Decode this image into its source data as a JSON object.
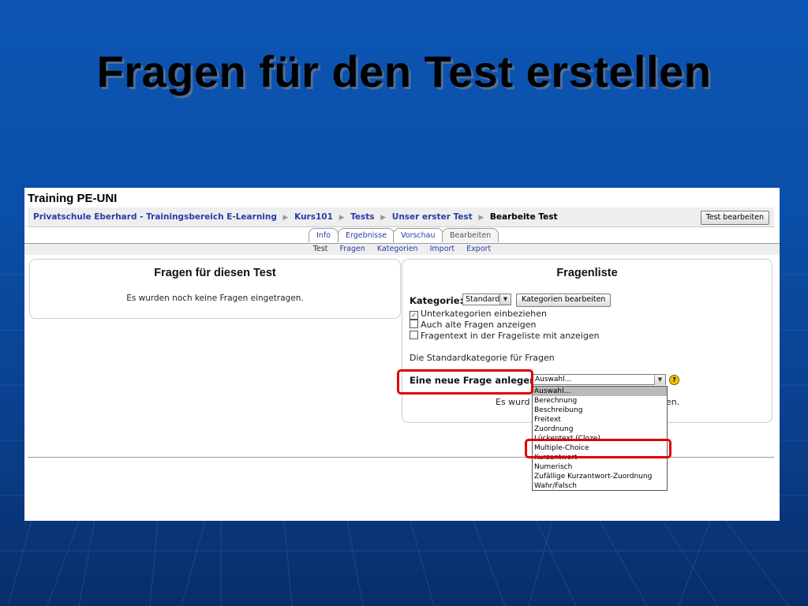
{
  "slide": {
    "title": "Fragen für den Test erstellen"
  },
  "app": {
    "title": "Training PE-UNI"
  },
  "breadcrumb": {
    "items": [
      "Privatschule Eberhard - Trainingsbereich E-Learning",
      "Kurs101",
      "Tests",
      "Unser erster Test"
    ],
    "current": "Bearbeite Test",
    "separator": "▶"
  },
  "header_button": "Test bearbeiten",
  "tabs": [
    {
      "label": "Info"
    },
    {
      "label": "Ergebnisse"
    },
    {
      "label": "Vorschau"
    },
    {
      "label": "Bearbeiten",
      "active": true
    }
  ],
  "subtabs": {
    "current": "Test",
    "links": [
      "Fragen",
      "Kategorien",
      "Import",
      "Export"
    ]
  },
  "left_panel": {
    "heading": "Fragen für diesen Test",
    "message": "Es wurden noch keine Fragen eingetragen."
  },
  "right_panel": {
    "heading": "Fragenliste",
    "kategorie_label": "Kategorie:",
    "kategorie_value": "Standard",
    "kategorie_button": "Kategorien bearbeiten",
    "checkboxes": [
      {
        "label": "Unterkategorien einbeziehen",
        "checked": true
      },
      {
        "label": "Auch alte Fragen anzeigen",
        "checked": false
      },
      {
        "label": "Fragentext in der Frageliste mit anzeigen",
        "checked": false
      }
    ],
    "category_description": "Die Standardkategorie für Fragen",
    "new_question_label": "Eine neue Frage anlegen:",
    "new_question_value": "Auswahl...",
    "partial_message_start": "Es wurd",
    "partial_message_end": "en."
  },
  "dropdown_options": [
    {
      "label": "Auswahl...",
      "selected": true
    },
    {
      "label": "Berechnung"
    },
    {
      "label": "Beschreibung"
    },
    {
      "label": "Freitext"
    },
    {
      "label": "Zuordnung"
    },
    {
      "label": "Lückentext (Cloze)"
    },
    {
      "label": "Multiple-Choice",
      "highlighted": true
    },
    {
      "label": "Kurzantwort"
    },
    {
      "label": "Numerisch"
    },
    {
      "label": "Zufällige Kurzantwort-Zuordnung"
    },
    {
      "label": "Wahr/Falsch"
    }
  ],
  "colors": {
    "link": "#2a3ba8",
    "highlight": "#e00000",
    "background_top": "#0d55b4",
    "background_bottom": "#082e6a"
  },
  "icons": {
    "help": "help-icon",
    "dropdown_arrow": "chevron-down-icon"
  }
}
